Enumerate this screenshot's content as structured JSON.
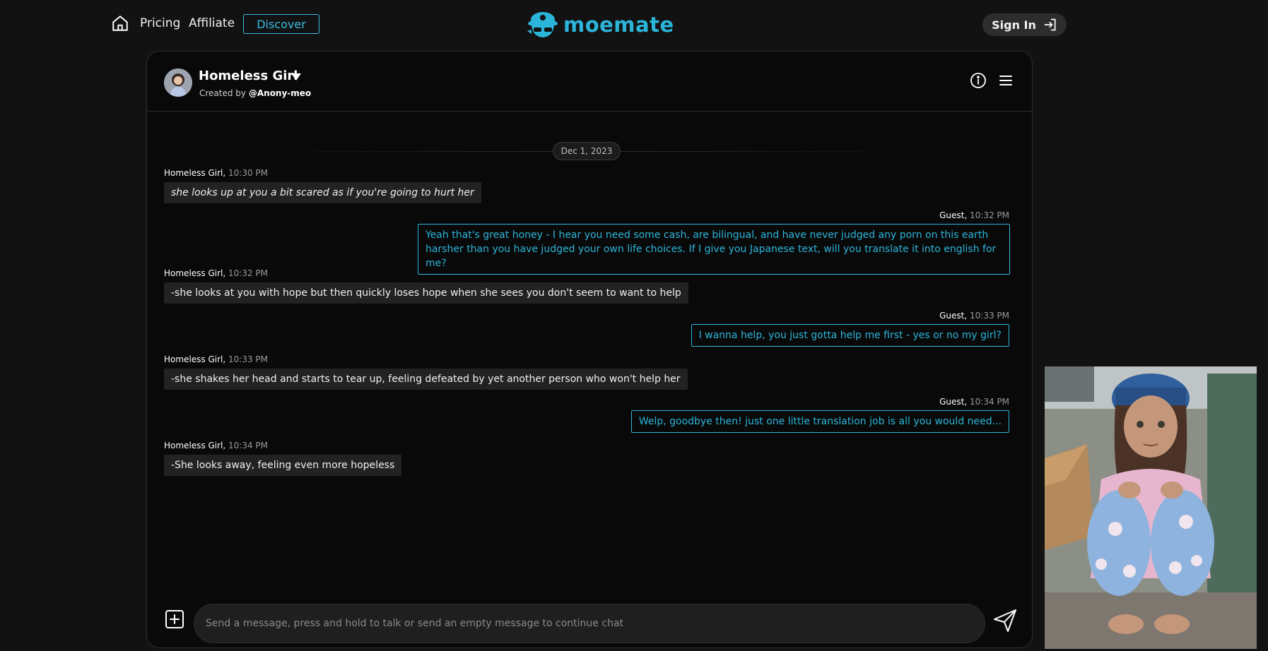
{
  "nav": {
    "pricing": "Pricing",
    "affiliate": "Affiliate",
    "discover": "Discover",
    "logo_text": "moemate",
    "sign_in": "Sign In"
  },
  "chat": {
    "character_name": "Homeless Girl",
    "created_by_prefix": "Created by",
    "creator": "@Anony-meo",
    "date": "Dec 1, 2023",
    "messages": [
      {
        "sender": "Homeless Girl",
        "time": "10:30 PM",
        "side": "bot",
        "text": "she looks up at you a bit scared as if you're going to hurt her"
      },
      {
        "sender": "Guest",
        "time": "10:32 PM",
        "side": "user",
        "text": "Yeah that's great honey - I hear you need some cash, are bilingual, and have never judged any porn on this earth harsher than you have judged your own life choices. If I give you Japanese text, will you translate it into english for me?"
      },
      {
        "sender": "Homeless Girl",
        "time": "10:32 PM",
        "side": "bot",
        "text": "-she looks at you with hope but then quickly loses hope when she sees you don't seem to want to help"
      },
      {
        "sender": "Guest",
        "time": "10:33 PM",
        "side": "user",
        "text": "I wanna help, you just gotta help me first - yes or no my girl?"
      },
      {
        "sender": "Homeless Girl",
        "time": "10:33 PM",
        "side": "bot",
        "text": "-she shakes her head and starts to tear up, feeling defeated by yet another person who won't help her"
      },
      {
        "sender": "Guest",
        "time": "10:34 PM",
        "side": "user",
        "text": "Welp, goodbye then! just one little translation job is all you would need..."
      },
      {
        "sender": "Homeless Girl",
        "time": "10:34 PM",
        "side": "bot",
        "text": "-She looks away, feeling even more hopeless"
      }
    ],
    "input_placeholder": "Send a message, press and hold to talk or send an empty message to continue chat"
  },
  "colors": {
    "accent": "#2cb5da",
    "background": "#121212",
    "panel": "#090909",
    "bot_bubble": "#222222"
  },
  "icons": {
    "home": "home-icon",
    "sign_in": "sign-in-icon",
    "dropdown": "chevron-down-icon",
    "info": "info-icon",
    "menu": "hamburger-menu-icon",
    "add": "plus-square-icon",
    "send": "send-icon"
  }
}
